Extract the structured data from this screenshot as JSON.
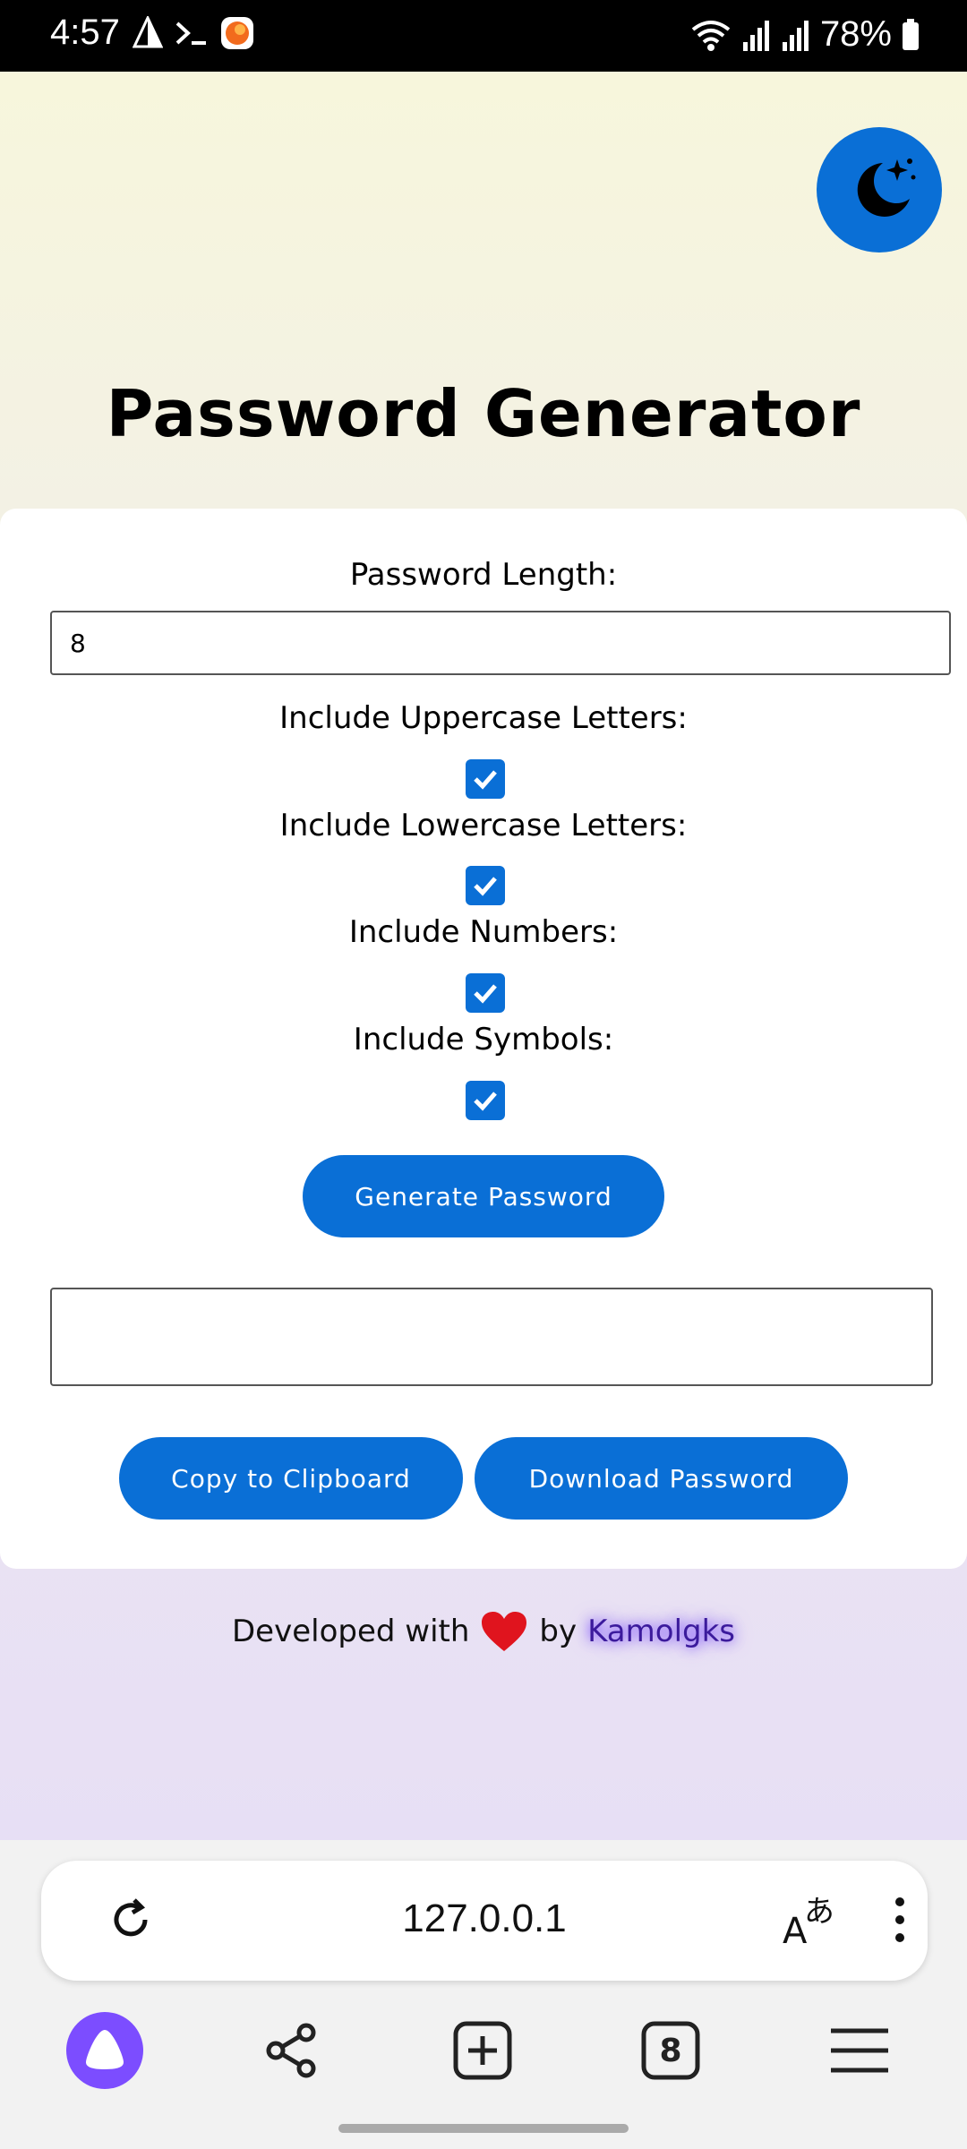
{
  "status_bar": {
    "time": "4:57",
    "battery": "78%"
  },
  "page": {
    "title": "Password Generator",
    "theme_toggle_icon": "moon-stars-icon"
  },
  "form": {
    "length_label": "Password Length:",
    "length_value": "8",
    "options": [
      {
        "label": "Include Uppercase Letters:",
        "checked": true
      },
      {
        "label": "Include Lowercase Letters:",
        "checked": true
      },
      {
        "label": "Include Numbers:",
        "checked": true
      },
      {
        "label": "Include Symbols:",
        "checked": true
      }
    ],
    "generate_label": "Generate Password",
    "output_value": "",
    "copy_label": "Copy to Clipboard",
    "download_label": "Download Password"
  },
  "footer": {
    "prefix": "Developed with",
    "heart_icon": "heart-icon",
    "by": "by",
    "author": "Kamolgks"
  },
  "browser": {
    "url": "127.0.0.1",
    "tab_count": "8"
  },
  "colors": {
    "accent": "#0a6fd6",
    "browser_brand": "#7c4dff"
  }
}
